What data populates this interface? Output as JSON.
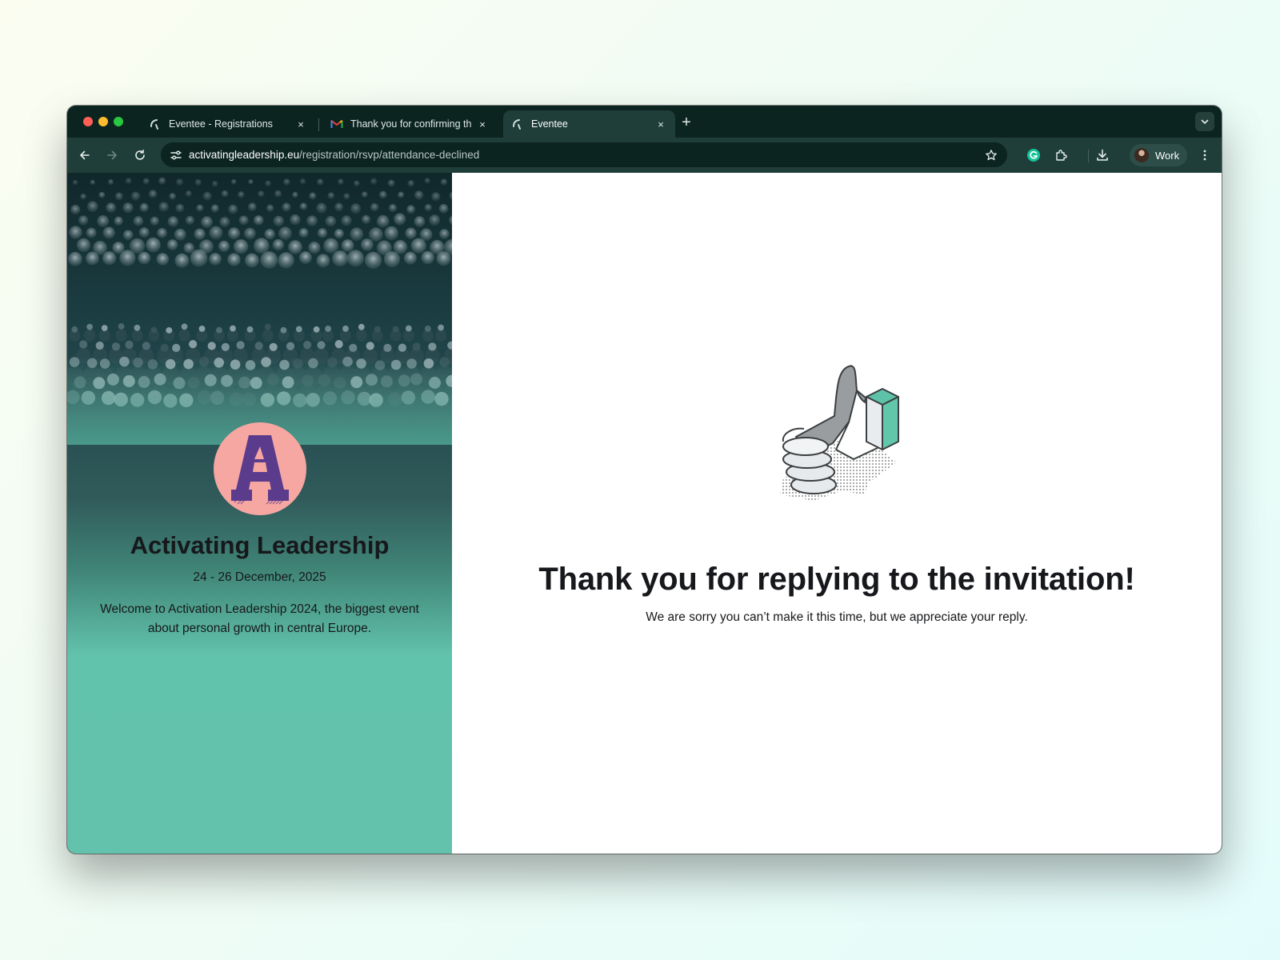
{
  "browser": {
    "tabs": [
      {
        "title": "Eventee - Registrations",
        "active": false,
        "favicon": "eventee-icon"
      },
      {
        "title": "Thank you for confirming the",
        "active": false,
        "favicon": "gmail-icon"
      },
      {
        "title": "Eventee",
        "active": true,
        "favicon": "eventee-icon"
      }
    ],
    "close_symbol": "×",
    "new_tab_symbol": "+",
    "url_host": "activatingleadership.eu",
    "url_path": "/registration/rsvp/attendance-declined",
    "profile_label": "Work"
  },
  "event": {
    "name": "Activating Leadership",
    "dates": "24 - 26 December, 2025",
    "description": "Welcome to Activation Leadership 2024, the biggest event about personal growth in central Europe."
  },
  "confirmation": {
    "heading": "Thank you for replying to the invitation!",
    "message": "We are sorry you can’t make it this time, but we appreciate your reply."
  },
  "colors": {
    "window_bg": "#0d2824",
    "toolbar_bg": "#1f3e39",
    "sidebar_teal": "#62c2ab",
    "logo_pink": "#f6a7a2",
    "logo_purple": "#5a3b8c",
    "text_dark": "#16181b"
  }
}
